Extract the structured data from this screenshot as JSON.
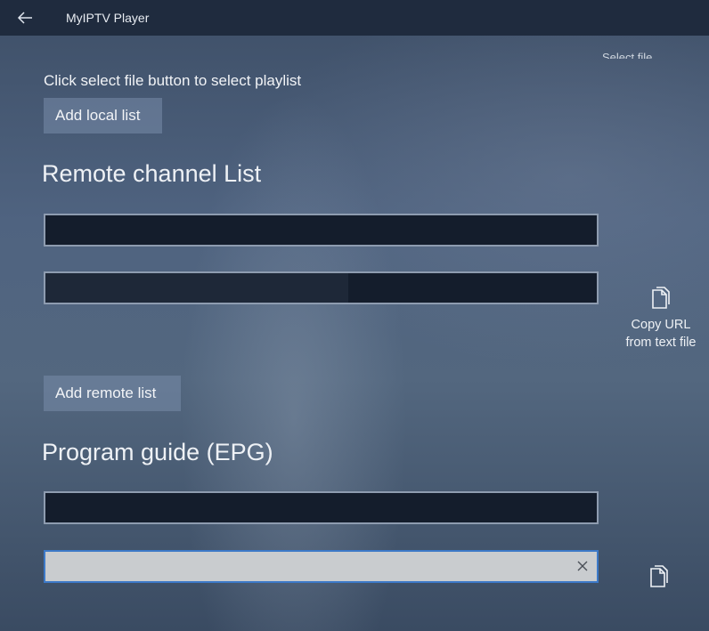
{
  "titlebar": {
    "app_title": "MyIPTV Player",
    "back_icon": "arrow-left-icon"
  },
  "top_right_cut_label": "Select file",
  "local": {
    "instruction": "Click select file button to select playlist",
    "add_button": "Add local list"
  },
  "remote": {
    "section_title": "Remote channel List",
    "name_field": {
      "value": "",
      "placeholder": ""
    },
    "url_field": {
      "value": "",
      "placeholder": ""
    },
    "copy_label": "Copy URL from text file",
    "copy_icon": "copy-icon",
    "add_button": "Add remote list"
  },
  "epg": {
    "section_title": "Program guide (EPG)",
    "name_field": {
      "value": "",
      "placeholder": ""
    },
    "url_field": {
      "value": "",
      "placeholder": ""
    },
    "clear_icon": "close-icon",
    "copy_icon": "copy-icon"
  },
  "colors": {
    "titlebar_bg": "#1f2b3e",
    "accent_focus": "#3c79c8",
    "field_border": "#8e9cb0",
    "button_bg": "#6f84a3"
  }
}
